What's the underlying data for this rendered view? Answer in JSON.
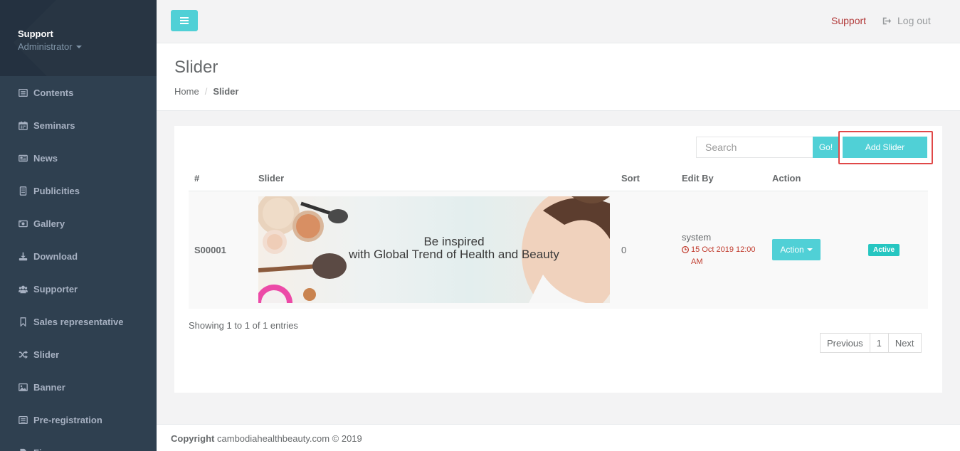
{
  "sidebar": {
    "profile_name": "Support",
    "profile_role": "Administrator",
    "items": [
      {
        "label": "Contents",
        "icon": "list-alt-icon"
      },
      {
        "label": "Seminars",
        "icon": "calendar-icon"
      },
      {
        "label": "News",
        "icon": "newspaper-icon"
      },
      {
        "label": "Publicities",
        "icon": "book-icon"
      },
      {
        "label": "Gallery",
        "icon": "image-icon"
      },
      {
        "label": "Download",
        "icon": "download-icon"
      },
      {
        "label": "Supporter",
        "icon": "users-icon"
      },
      {
        "label": "Sales representative",
        "icon": "bookmark-icon"
      },
      {
        "label": "Slider",
        "icon": "random-icon"
      },
      {
        "label": "Banner",
        "icon": "picture-icon"
      },
      {
        "label": "Pre-registration",
        "icon": "list-icon"
      },
      {
        "label": "Fi",
        "icon": "file-icon"
      }
    ]
  },
  "topbar": {
    "support_label": "Support",
    "logout_label": "Log out"
  },
  "page": {
    "title": "Slider",
    "breadcrumb_home": "Home",
    "breadcrumb_sep": "/",
    "breadcrumb_current": "Slider"
  },
  "toolbar": {
    "search_placeholder": "Search",
    "go_label": "Go!",
    "add_label": "Add Slider"
  },
  "table": {
    "headers": [
      "#",
      "Slider",
      "Sort",
      "Edit By",
      "Action",
      ""
    ],
    "rows": [
      {
        "id": "S00001",
        "slide_line1": "Be inspired",
        "slide_line2": "with Global Trend of Health and Beauty",
        "sort": "0",
        "edit_by": "system",
        "edit_date": "15 Oct 2019 12:00 AM",
        "action_label": "Action",
        "status": "Active"
      }
    ]
  },
  "pagination": {
    "info": "Showing 1 to 1 of 1 entries",
    "previous": "Previous",
    "page": "1",
    "next": "Next"
  },
  "footer": {
    "label": "Copyright",
    "text": "cambodiahealthbeauty.com © 2019"
  },
  "colors": {
    "accent": "#50d0d6",
    "sidebar": "#2f4050",
    "danger": "#c0392b",
    "highlight": "#e04848"
  }
}
